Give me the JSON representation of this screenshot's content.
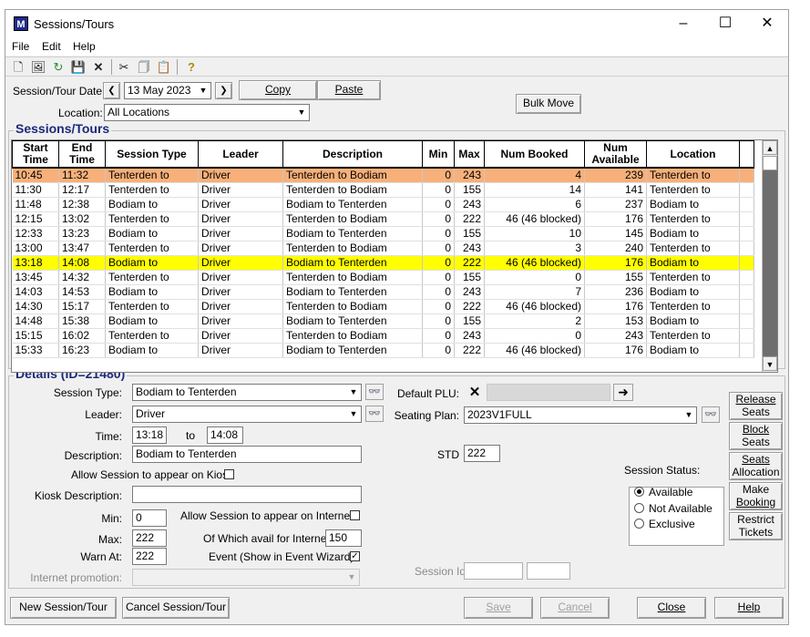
{
  "window": {
    "title": "Sessions/Tours",
    "app_icon_letter": "M"
  },
  "menu": [
    "File",
    "Edit",
    "Help"
  ],
  "toolbar_icons": [
    "new-icon",
    "open-icon",
    "refresh-icon",
    "save-icon",
    "delete-icon",
    "cut-icon",
    "copy-icon",
    "paste-icon",
    "help-icon"
  ],
  "filter": {
    "date_label": "Session/Tour Date:",
    "date_value": "13 May 2023",
    "copy_label": "Copy",
    "paste_label": "Paste",
    "bulk_move_label": "Bulk Move",
    "location_label": "Location:",
    "location_value": "All Locations"
  },
  "grid": {
    "title": "Sessions/Tours",
    "columns": [
      "Start Time",
      "End Time",
      "Session Type",
      "Leader",
      "Description",
      "Min",
      "Max",
      "Num Booked",
      "Num Available",
      "Location"
    ],
    "rows": [
      {
        "start": "10:45",
        "end": "11:32",
        "type": "Tenterden to",
        "leader": "Driver",
        "desc": "Tenterden to Bodiam",
        "min": "0",
        "max": "243",
        "booked": "4",
        "avail": "239",
        "loc": "Tenterden to",
        "hl": "orange"
      },
      {
        "start": "11:30",
        "end": "12:17",
        "type": "Tenterden to",
        "leader": "Driver",
        "desc": "Tenterden to Bodiam",
        "min": "0",
        "max": "155",
        "booked": "14",
        "avail": "141",
        "loc": "Tenterden to",
        "hl": ""
      },
      {
        "start": "11:48",
        "end": "12:38",
        "type": "Bodiam to",
        "leader": "Driver",
        "desc": "Bodiam to Tenterden",
        "min": "0",
        "max": "243",
        "booked": "6",
        "avail": "237",
        "loc": "Bodiam to",
        "hl": ""
      },
      {
        "start": "12:15",
        "end": "13:02",
        "type": "Tenterden to",
        "leader": "Driver",
        "desc": "Tenterden to Bodiam",
        "min": "0",
        "max": "222",
        "booked": "46 (46 blocked)",
        "avail": "176",
        "loc": "Tenterden to",
        "hl": ""
      },
      {
        "start": "12:33",
        "end": "13:23",
        "type": "Bodiam to",
        "leader": "Driver",
        "desc": "Bodiam to Tenterden",
        "min": "0",
        "max": "155",
        "booked": "10",
        "avail": "145",
        "loc": "Bodiam to",
        "hl": ""
      },
      {
        "start": "13:00",
        "end": "13:47",
        "type": "Tenterden to",
        "leader": "Driver",
        "desc": "Tenterden to Bodiam",
        "min": "0",
        "max": "243",
        "booked": "3",
        "avail": "240",
        "loc": "Tenterden to",
        "hl": ""
      },
      {
        "start": "13:18",
        "end": "14:08",
        "type": "Bodiam to",
        "leader": "Driver",
        "desc": "Bodiam to Tenterden",
        "min": "0",
        "max": "222",
        "booked": "46 (46 blocked)",
        "avail": "176",
        "loc": "Bodiam to",
        "hl": "yellow"
      },
      {
        "start": "13:45",
        "end": "14:32",
        "type": "Tenterden to",
        "leader": "Driver",
        "desc": "Tenterden to Bodiam",
        "min": "0",
        "max": "155",
        "booked": "0",
        "avail": "155",
        "loc": "Tenterden to",
        "hl": ""
      },
      {
        "start": "14:03",
        "end": "14:53",
        "type": "Bodiam to",
        "leader": "Driver",
        "desc": "Bodiam to Tenterden",
        "min": "0",
        "max": "243",
        "booked": "7",
        "avail": "236",
        "loc": "Bodiam to",
        "hl": ""
      },
      {
        "start": "14:30",
        "end": "15:17",
        "type": "Tenterden to",
        "leader": "Driver",
        "desc": "Tenterden to Bodiam",
        "min": "0",
        "max": "222",
        "booked": "46 (46 blocked)",
        "avail": "176",
        "loc": "Tenterden to",
        "hl": ""
      },
      {
        "start": "14:48",
        "end": "15:38",
        "type": "Bodiam to",
        "leader": "Driver",
        "desc": "Bodiam to Tenterden",
        "min": "0",
        "max": "155",
        "booked": "2",
        "avail": "153",
        "loc": "Bodiam to",
        "hl": ""
      },
      {
        "start": "15:15",
        "end": "16:02",
        "type": "Tenterden to",
        "leader": "Driver",
        "desc": "Tenterden to Bodiam",
        "min": "0",
        "max": "243",
        "booked": "0",
        "avail": "243",
        "loc": "Tenterden to",
        "hl": ""
      },
      {
        "start": "15:33",
        "end": "16:23",
        "type": "Bodiam to",
        "leader": "Driver",
        "desc": "Bodiam to Tenterden",
        "min": "0",
        "max": "222",
        "booked": "46 (46 blocked)",
        "avail": "176",
        "loc": "Bodiam to",
        "hl": ""
      }
    ]
  },
  "details": {
    "title": "Details (ID=21480)",
    "session_type_label": "Session Type:",
    "session_type_value": "Bodiam to Tenterden",
    "leader_label": "Leader:",
    "leader_value": "Driver",
    "time_label": "Time:",
    "time_from": "13:18",
    "time_to_label": "to",
    "time_to": "14:08",
    "description_label": "Description:",
    "description_value": "Bodiam to Tenterden",
    "kiosk_allow_label": "Allow Session to appear on Kiosk",
    "kiosk_desc_label": "Kiosk Description:",
    "kiosk_desc_value": "",
    "min_label": "Min:",
    "min_value": "0",
    "max_label": "Max:",
    "max_value": "222",
    "warn_label": "Warn At:",
    "warn_value": "222",
    "internet_allow_label": "Allow Session to appear on Internet",
    "internet_avail_label": "Of Which avail for Internet:",
    "internet_avail_value": "150",
    "event_label": "Event (Show in Event Wizard)",
    "internet_promo_label": "Internet promotion:",
    "default_plu_label": "Default PLU:",
    "seating_plan_label": "Seating Plan:",
    "seating_plan_value": "2023V1FULL",
    "std_label": "STD",
    "std_value": "222",
    "session_status_label": "Session Status:",
    "status_options": [
      "Available",
      "Not Available",
      "Exclusive"
    ],
    "session_id_label": "Session Id"
  },
  "side_buttons": [
    {
      "l1": "Release",
      "l2": "Seats"
    },
    {
      "l1": "Block",
      "l2": "Seats"
    },
    {
      "l1": "Seats",
      "l2": "Allocation"
    },
    {
      "l1": "Make",
      "l2": "Booking"
    },
    {
      "l1": "Restrict",
      "l2": "Tickets"
    }
  ],
  "bottom_buttons": {
    "new": "New Session/Tour",
    "cancel_session": "Cancel Session/Tour",
    "save": "Save",
    "cancel": "Cancel",
    "close": "Close",
    "help": "Help"
  }
}
